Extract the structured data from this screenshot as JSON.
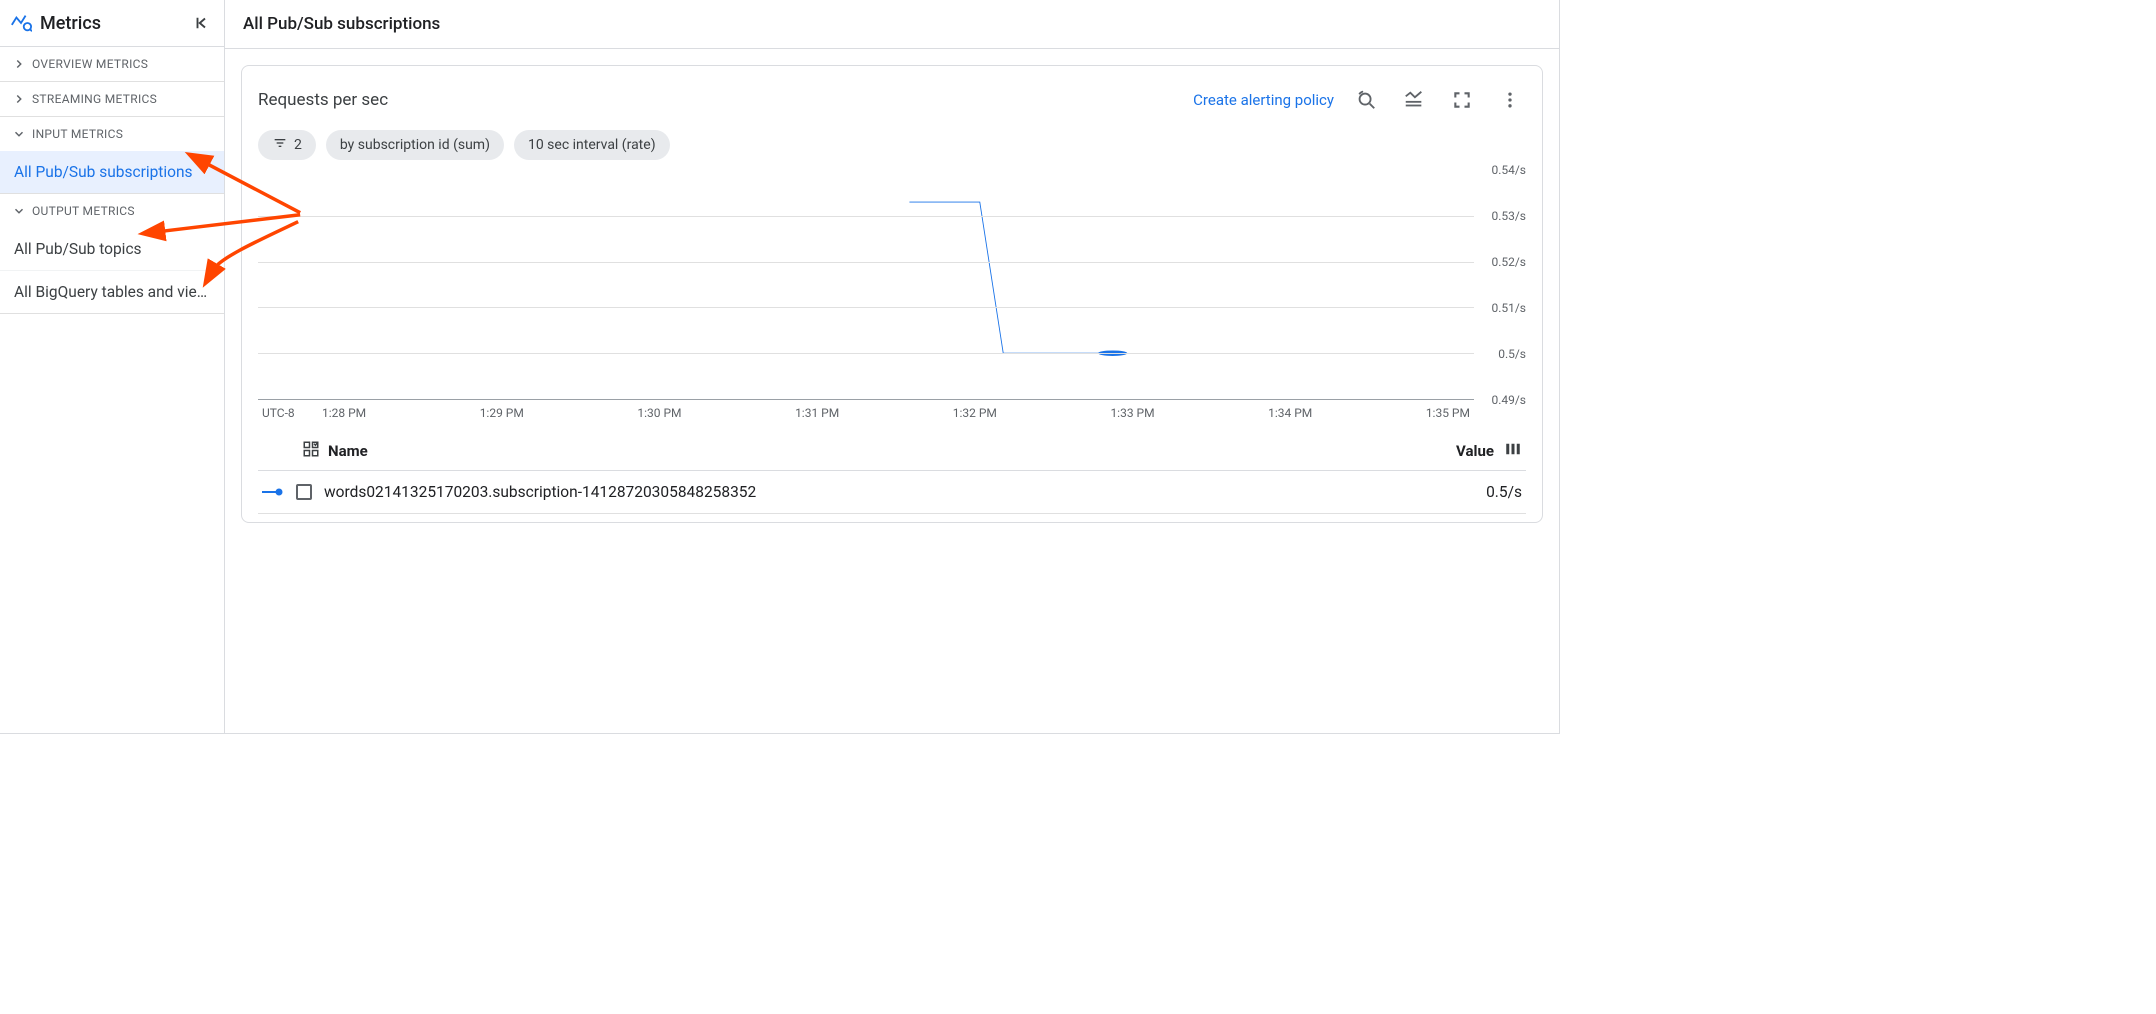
{
  "sidebar": {
    "title": "Metrics",
    "groups": [
      {
        "label": "OVERVIEW METRICS",
        "expanded": false,
        "items": []
      },
      {
        "label": "STREAMING METRICS",
        "expanded": false,
        "items": []
      },
      {
        "label": "INPUT METRICS",
        "expanded": true,
        "items": [
          {
            "label": "All Pub/Sub subscriptions",
            "selected": true
          }
        ]
      },
      {
        "label": "OUTPUT METRICS",
        "expanded": true,
        "items": [
          {
            "label": "All Pub/Sub topics",
            "selected": false
          },
          {
            "label": "All BigQuery tables and vie…",
            "selected": false
          }
        ]
      }
    ]
  },
  "page_title": "All Pub/Sub subscriptions",
  "card": {
    "title": "Requests per sec",
    "create_alert": "Create alerting policy",
    "chips": [
      {
        "icon": "filter",
        "text": "2"
      },
      {
        "text": "by subscription id (sum)"
      },
      {
        "text": "10 sec interval (rate)"
      }
    ]
  },
  "legend": {
    "name_header": "Name",
    "value_header": "Value",
    "rows": [
      {
        "name": "words02141325170203.subscription-14128720305848258352",
        "value": "0.5/s"
      }
    ]
  },
  "chart_data": {
    "type": "line",
    "title": "Requests per sec",
    "xlabel": "UTC-8",
    "ylabel": "",
    "ylim": [
      0.49,
      0.54
    ],
    "y_ticks": [
      "0.54/s",
      "0.53/s",
      "0.52/s",
      "0.51/s",
      "0.5/s",
      "0.49/s"
    ],
    "x_ticks": [
      "1:28 PM",
      "1:29 PM",
      "1:30 PM",
      "1:31 PM",
      "1:32 PM",
      "1:33 PM",
      "1:34 PM",
      "1:35 PM"
    ],
    "series": [
      {
        "name": "words02141325170203.subscription-14128720305848258352",
        "color": "#1a73e8",
        "points": [
          {
            "x_index": 3.7,
            "y": 0.533
          },
          {
            "x_index": 4.15,
            "y": 0.533
          },
          {
            "x_index": 4.3,
            "y": 0.5
          },
          {
            "x_index": 5.0,
            "y": 0.5
          }
        ],
        "marker_at": {
          "x_index": 5.0,
          "y": 0.5
        }
      }
    ]
  }
}
